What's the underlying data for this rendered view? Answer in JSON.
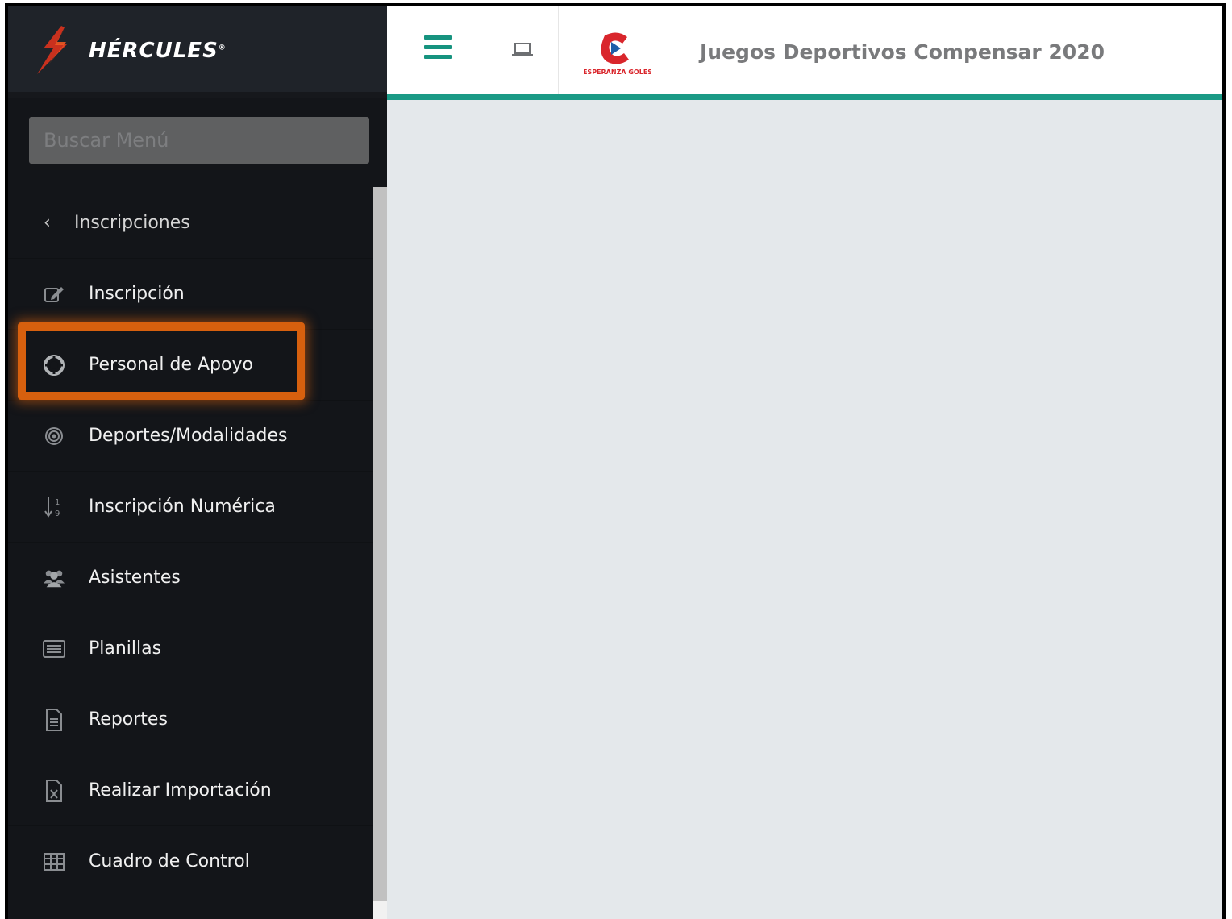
{
  "brand": {
    "name": "HÉRCULES",
    "mark": "®"
  },
  "search": {
    "placeholder": "Buscar Menú"
  },
  "sidebar": {
    "back_label": "Inscripciones",
    "items": [
      {
        "label": "Inscripción",
        "icon": "edit-icon"
      },
      {
        "label": "Personal de Apoyo",
        "icon": "life-ring-icon",
        "highlighted": true
      },
      {
        "label": "Deportes/Modalidades",
        "icon": "bullseye-icon"
      },
      {
        "label": "Inscripción Numérica",
        "icon": "sort-numeric-icon"
      },
      {
        "label": "Asistentes",
        "icon": "users-icon"
      },
      {
        "label": "Planillas",
        "icon": "list-alt-icon"
      },
      {
        "label": "Reportes",
        "icon": "file-text-icon"
      },
      {
        "label": "Realizar Importación",
        "icon": "file-excel-icon"
      },
      {
        "label": "Cuadro de Control",
        "icon": "table-icon"
      }
    ]
  },
  "topbar": {
    "title": "Juegos Deportivos Compensar 2020",
    "club_logo_text": "ESPERANZA GOLES"
  },
  "colors": {
    "accent": "#1a9a86",
    "highlight": "#d7600e",
    "sidebar_bg": "#131519",
    "content_bg": "#e4e8eb"
  }
}
